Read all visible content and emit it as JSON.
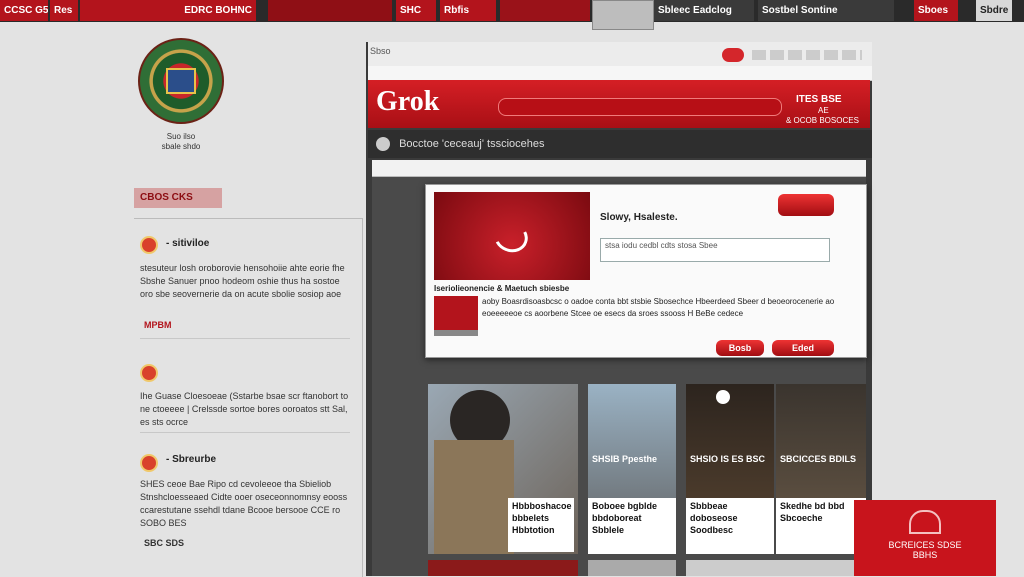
{
  "tabs": [
    {
      "label": "CCSC G5",
      "style": "red"
    },
    {
      "label": "Res",
      "style": "red"
    },
    {
      "label": "EDRC BOHNC",
      "style": "red"
    },
    {
      "label": "",
      "style": "red"
    },
    {
      "label": "SHC",
      "style": "red"
    },
    {
      "label": "Rbfis",
      "style": "red"
    },
    {
      "label": "",
      "style": "grey"
    },
    {
      "label": "Sbleec Eadclog",
      "style": "dark"
    },
    {
      "label": "Sostbel Sontine",
      "style": "dark"
    },
    {
      "label": "Sboes",
      "style": "red"
    },
    {
      "label": "Sbdre",
      "style": "grey"
    }
  ],
  "sidebar": {
    "caption_line1": "Suo ilso",
    "caption_line2": "sbale shdo",
    "tag": "CBOS CKS",
    "items": [
      {
        "title": "- sitiviloe",
        "body": "stesuteur losh oroborovie hensohoiie ahte eorie fhe Sbshe Sanuer pnoo hodeom oshie thus ha sostoe oro sbe seovernerie da on acute sbolie sosiop aoe",
        "link": "MPBM"
      },
      {
        "title": "",
        "body": "Ihe Guase Cloesoeae (Sstarbe bsae scr ftanobort to ne ctoeeee | Crelssde sortoe bores ooroatos stt Sal, es sts ocrce",
        "link": ""
      },
      {
        "title": "- Sbreurbe",
        "body": "SHES ceoe Bae Ripo cd cevoleeoe tha Sbieliob Stnshcloesseaed Cidte ooer oseceonnomnsy eooss ccarestutane ssehdl tdane Bcooe bersooe CCE ro SOBO BES",
        "link": "SBC SDS"
      }
    ]
  },
  "browser": {
    "tab_title": "Sbso",
    "logo": "Grok",
    "banner_right_line1": "ITES BSE",
    "banner_right_line2": "AE",
    "banner_right_line3": "& OCOB BOSOCES",
    "sub_title": "Bocctoe 'ceceauj' tssciocehes",
    "dialog": {
      "heading": "Slowy, Hsaleste.",
      "input_text": "stsa iodu cedbl cdts stosa Sbee",
      "article_title": "Iseriolieonencie & Maetuch sbiesbe",
      "article_body": "aoby Boasrdisoasbcsc o oadoe conta bbt stsbie Sbosechce Hbeerdeed Sbeer d beoeorocenerie ao eoeeeeeoe cs aoorbene Stcee oe esecs da sroes ssooss H BeBe cedece",
      "btn_top": "",
      "btn_left": "Bosb",
      "btn_right": "Eded"
    },
    "cards": [
      {
        "caption": "Hbbboshacoe bbbelets Hbbtotion"
      },
      {
        "overlay": "SHSIB Ppesthe",
        "caption": "Boboee bgblde bbdoboreat Sbblele"
      },
      {
        "overlay": "SHSIO IS ES BSC",
        "caption": "Sbbbeae doboseose Soodbesc"
      },
      {
        "overlay": "SBCICCES BDILS",
        "caption": "Skedhe bd bbd Sbcoeche"
      }
    ],
    "red_card_line1": "BCREICES SDSE",
    "red_card_line2": "BBHS"
  }
}
